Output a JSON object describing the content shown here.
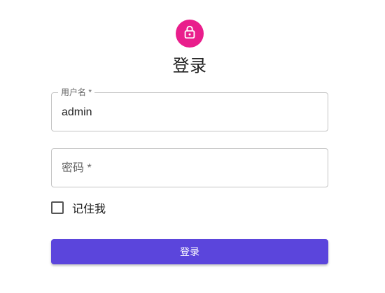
{
  "header": {
    "icon": "lock-icon",
    "icon_color": "#e91e8c",
    "title": "登录"
  },
  "form": {
    "username": {
      "label": "用户名 *",
      "value": "admin"
    },
    "password": {
      "placeholder": "密码 *",
      "value": ""
    },
    "remember": {
      "label": "记住我",
      "checked": false
    },
    "submit_label": "登录",
    "submit_color": "#5b45dc"
  }
}
